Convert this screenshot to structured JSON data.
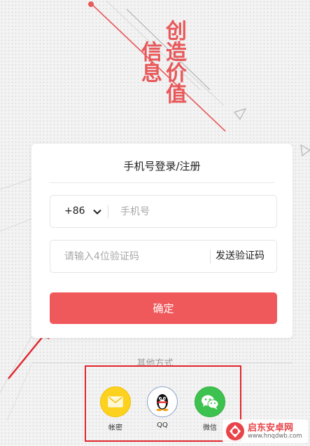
{
  "slogan": {
    "column1": "创造价值",
    "column2": "信息"
  },
  "login": {
    "title": "手机号登录/注册",
    "country_code": "+86",
    "phone_placeholder": "手机号",
    "code_placeholder": "请输入4位验证码",
    "send_code_label": "发送验证码",
    "confirm_label": "确定"
  },
  "other_methods": {
    "label": "其他方式",
    "options": [
      {
        "label": "帐密",
        "icon": "envelope-icon"
      },
      {
        "label": "QQ",
        "icon": "qq-penguin-icon"
      },
      {
        "label": "微信",
        "icon": "wechat-icon"
      }
    ]
  },
  "watermark": {
    "name": "启东安卓网",
    "url": "www.hnqdwb.com"
  },
  "colors": {
    "accent": "#f0595c",
    "slogan": "#e8585a",
    "annotation": "#e0262c",
    "account_icon_bg": "#fdd21f",
    "wechat_icon_bg": "#3dc24f"
  }
}
